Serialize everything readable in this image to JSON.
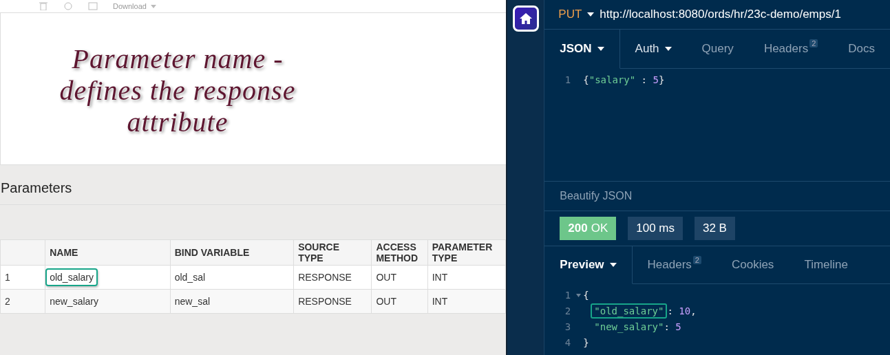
{
  "toolbar": {
    "download_label": "Download"
  },
  "annotation": {
    "lines": [
      "Parameter name -",
      "defines the response",
      "attribute"
    ]
  },
  "parameters": {
    "title": "Parameters",
    "columns": [
      "",
      "NAME",
      "BIND VARIABLE",
      "SOURCE TYPE",
      "ACCESS METHOD",
      "PARAMETER TYPE"
    ],
    "rows": [
      {
        "cells": [
          "1",
          "old_salary",
          "old_sal",
          "RESPONSE",
          "OUT",
          "INT"
        ],
        "highlighted": true
      },
      {
        "cells": [
          "2",
          "new_salary",
          "new_sal",
          "RESPONSE",
          "OUT",
          "INT"
        ],
        "highlighted": false
      }
    ]
  },
  "request": {
    "method": "PUT",
    "url": "http://localhost:8080/ords/hr/23c-demo/emps/1",
    "tabs": [
      {
        "label": "JSON",
        "dropdown": true,
        "selected": true
      },
      {
        "label": "Auth",
        "dropdown": true,
        "selected": false
      },
      {
        "label": "Query",
        "dropdown": false,
        "selected": false
      },
      {
        "label": "Headers",
        "badge": "2",
        "dropdown": false,
        "selected": false
      },
      {
        "label": "Docs",
        "dropdown": false,
        "selected": false
      }
    ],
    "lines": [
      {
        "number": "1",
        "fold": false,
        "indented": false,
        "tokens": [
          {
            "kind": "punct",
            "text": "{",
            "highlighted": false
          },
          {
            "kind": "key",
            "text": "\"salary\"",
            "highlighted": false
          },
          {
            "kind": "punct",
            "text": " : ",
            "highlighted": false
          },
          {
            "kind": "number",
            "text": "5",
            "highlighted": false
          },
          {
            "kind": "punct",
            "text": "}",
            "highlighted": false
          }
        ]
      }
    ]
  },
  "beautify_label": "Beautify JSON",
  "response": {
    "status_code": "200",
    "status_text": "OK",
    "time": "100 ms",
    "size": "32 B",
    "tabs": [
      {
        "label": "Preview",
        "dropdown": true,
        "selected": true
      },
      {
        "label": "Headers",
        "badge": "2",
        "dropdown": false,
        "selected": false
      },
      {
        "label": "Cookies",
        "dropdown": false,
        "selected": false
      },
      {
        "label": "Timeline",
        "dropdown": false,
        "selected": false
      }
    ],
    "lines": [
      {
        "number": "1",
        "fold": true,
        "indented": false,
        "tokens": [
          {
            "kind": "punct",
            "text": "{",
            "highlighted": false
          }
        ]
      },
      {
        "number": "2",
        "fold": false,
        "indented": true,
        "tokens": [
          {
            "kind": "key",
            "text": "\"old_salary\"",
            "highlighted": true
          },
          {
            "kind": "punct",
            "text": ": ",
            "highlighted": false
          },
          {
            "kind": "number",
            "text": "10",
            "highlighted": false
          },
          {
            "kind": "punct",
            "text": ",",
            "highlighted": false
          }
        ]
      },
      {
        "number": "3",
        "fold": false,
        "indented": true,
        "tokens": [
          {
            "kind": "key",
            "text": "\"new_salary\"",
            "highlighted": false
          },
          {
            "kind": "punct",
            "text": ": ",
            "highlighted": false
          },
          {
            "kind": "number",
            "text": "5",
            "highlighted": false
          }
        ]
      },
      {
        "number": "4",
        "fold": false,
        "indented": false,
        "tokens": [
          {
            "kind": "punct",
            "text": "}",
            "highlighted": false
          }
        ]
      }
    ]
  }
}
